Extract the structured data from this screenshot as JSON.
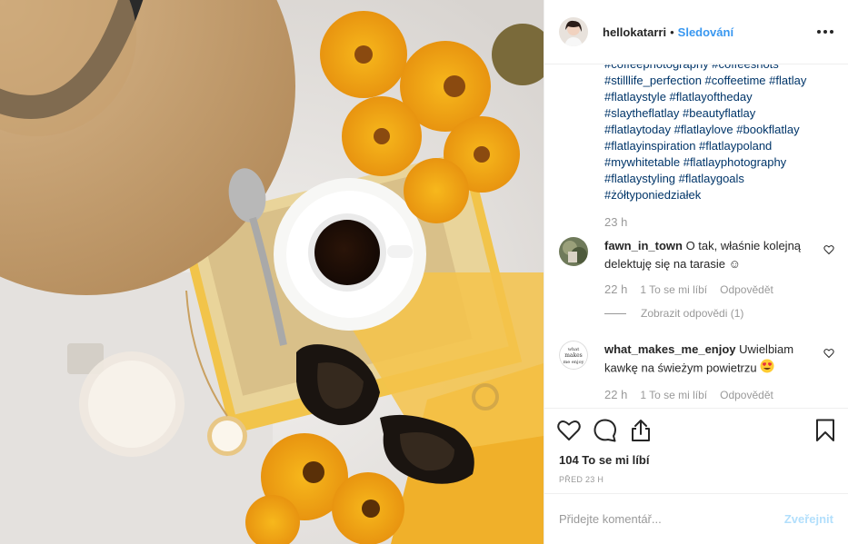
{
  "header": {
    "username": "hellokatarri",
    "separator": "•",
    "follow_label": "Sledování"
  },
  "caption": {
    "hashtag_lines": [
      "#coffeephotography #coffeeshots",
      "#stilllife_perfection #coffeetime #flatlay",
      "#flatlaystyle #flatlayoftheday",
      "#slaytheflatlay #beautyflatlay",
      "#flatlaytoday #flatlaylove #bookflatlay",
      "#flatlayinspiration #flatlaypoland",
      "#mywhitetable #flatlayphotography",
      "#flatlaystyling #flatlaygoals",
      "#żółtyponiedziałek"
    ],
    "time": "23 h"
  },
  "comments": [
    {
      "username": "fawn_in_town",
      "text": "O tak, właśnie kolejną delektuję się na tarasie ☺",
      "time": "22 h",
      "likes_label": "1 To se mi líbí",
      "reply_label": "Odpovědět",
      "view_replies": "Zobrazit odpovědi (1)"
    },
    {
      "username": "what_makes_me_enjoy",
      "text": "Uwielbiam kawkę na świeżym powietrzu",
      "emoji": "heart-eyes-emoji",
      "avatar_text": "what makes me enjoy",
      "time": "22 h",
      "likes_label": "1 To se mi líbí",
      "reply_label": "Odpovědět"
    }
  ],
  "actions": {
    "icons": [
      "heart-icon",
      "comment-icon",
      "share-icon",
      "bookmark-icon"
    ]
  },
  "likes": "104 To se mi líbí",
  "posted_ago": "PŘED 23 H",
  "add_comment": {
    "placeholder": "Přidejte komentář...",
    "post_label": "Zveřejnit"
  },
  "colors": {
    "link": "#003569",
    "follow": "#3897f0",
    "muted": "#999999",
    "post_disabled": "#b2dffc"
  }
}
